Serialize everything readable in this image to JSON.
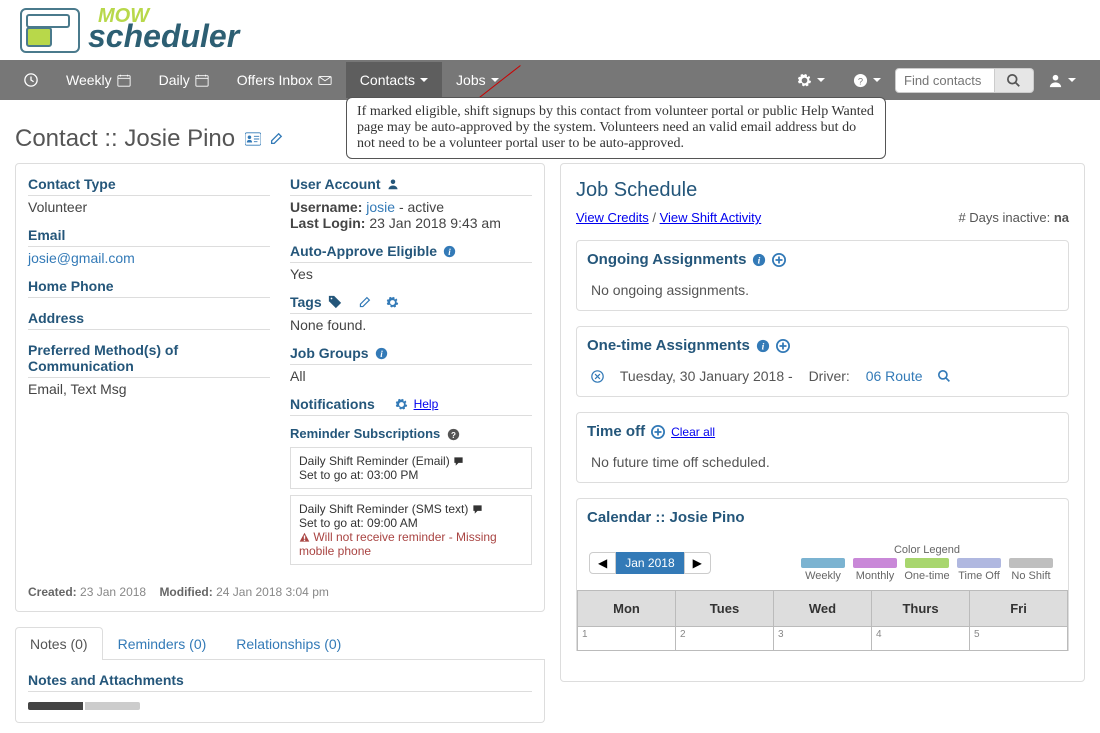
{
  "nav": {
    "weekly": "Weekly",
    "daily": "Daily",
    "offers": "Offers Inbox",
    "contacts": "Contacts",
    "jobs": "Jobs",
    "search_placeholder": "Find contacts"
  },
  "tooltip": "If marked eligible, shift signups by this contact from volunteer portal or public Help Wanted page may be auto-approved by the system. Volunteers need an valid email address but do not need to be a volunteer portal user to be auto-approved.",
  "page_title": "Contact :: Josie Pino",
  "left": {
    "contact_type_label": "Contact Type",
    "contact_type_value": "Volunteer",
    "email_label": "Email",
    "email_value": "josie@gmail.com",
    "home_phone_label": "Home Phone",
    "address_label": "Address",
    "pref_comm_label": "Preferred Method(s) of Communication",
    "pref_comm_value": "Email, Text Msg",
    "user_account_label": "User Account",
    "username_label": "Username:",
    "username_value": "josie",
    "username_status": " - active",
    "last_login_label": "Last Login:",
    "last_login_value": "23 Jan 2018 9:43 am",
    "auto_approve_label": "Auto-Approve Eligible",
    "auto_approve_value": "Yes",
    "tags_label": "Tags",
    "tags_value": "None found.",
    "job_groups_label": "Job Groups",
    "job_groups_value": "All",
    "notifications_label": "Notifications",
    "notifications_help": "Help",
    "reminder_subs_label": "Reminder Subscriptions",
    "reminder1_title": "Daily Shift Reminder (Email)",
    "reminder1_time": "Set to go at: 03:00 PM",
    "reminder2_title": "Daily Shift Reminder (SMS text)",
    "reminder2_time": "Set to go at: 09:00 AM",
    "reminder2_warn": "Will not receive reminder - Missing mobile phone",
    "created_label": "Created:",
    "created_value": "23 Jan 2018",
    "modified_label": "Modified:",
    "modified_value": "24 Jan 2018 3:04 pm"
  },
  "tabs": {
    "notes": "Notes (0)",
    "reminders": "Reminders (0)",
    "relationships": "Relationships (0)",
    "notes_heading": "Notes and Attachments"
  },
  "right": {
    "job_schedule": "Job Schedule",
    "view_credits": "View Credits",
    "view_shift": "View Shift Activity",
    "days_inactive_label": "# Days inactive:",
    "days_inactive_value": "na",
    "ongoing_title": "Ongoing Assignments",
    "ongoing_body": "No ongoing assignments.",
    "onetime_title": "One-time Assignments",
    "onetime_date": "Tuesday, 30 January 2018 -",
    "onetime_driver": "Driver:",
    "onetime_route": "06 Route",
    "timeoff_title": "Time off",
    "timeoff_clear": "Clear all",
    "timeoff_body": "No future time off scheduled.",
    "calendar_title": "Calendar :: Josie Pino",
    "cal_month": "Jan 2018",
    "legend_title": "Color Legend",
    "legend": [
      "Weekly",
      "Monthly",
      "One-time",
      "Time Off",
      "No Shift"
    ],
    "legend_colors": [
      "#7bb3d1",
      "#c988d8",
      "#a8d66e",
      "#b0b8e0",
      "#bfbfbf"
    ],
    "days": [
      "Mon",
      "Tues",
      "Wed",
      "Thurs",
      "Fri"
    ],
    "dates": [
      "1",
      "2",
      "3",
      "4",
      "5"
    ]
  }
}
